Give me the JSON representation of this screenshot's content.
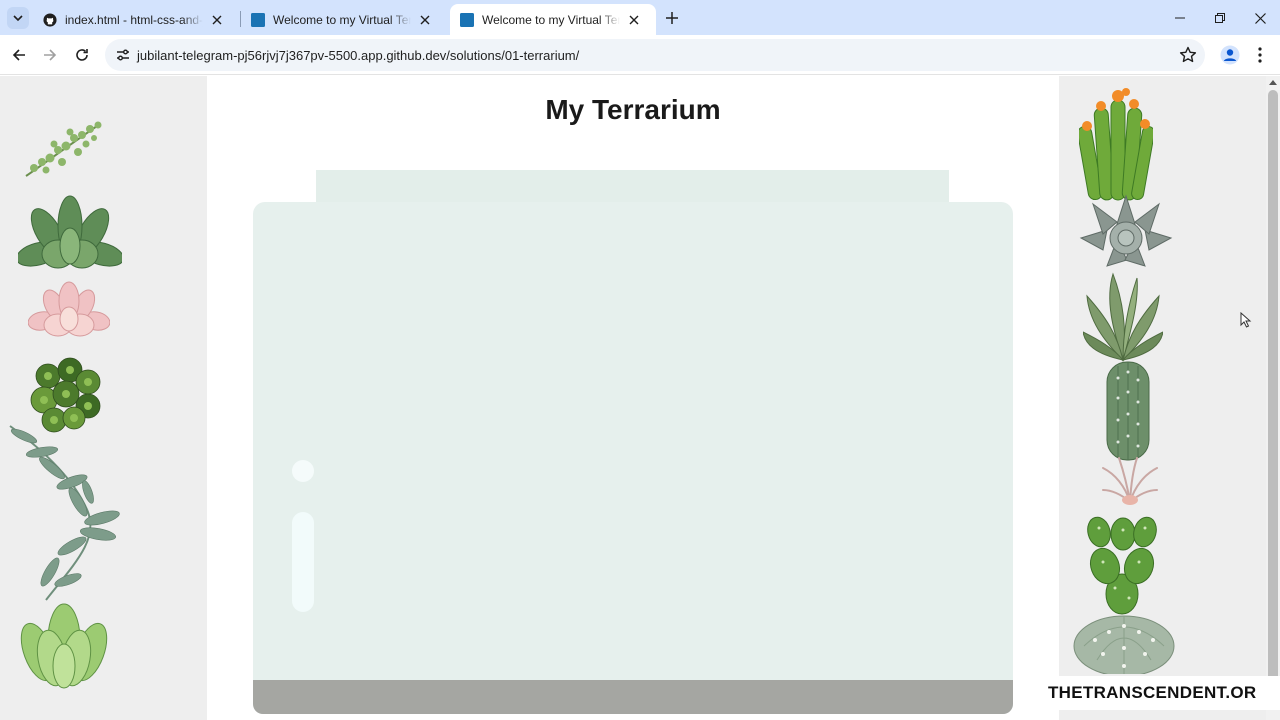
{
  "browser": {
    "tabs": [
      {
        "title": "index.html - html-css-and-javas",
        "favicon": "github-icon",
        "active": false
      },
      {
        "title": "Welcome to my Virtual Terrarium",
        "favicon": "vscode-icon",
        "active": false
      },
      {
        "title": "Welcome to my Virtual Terrarium",
        "favicon": "vscode-icon",
        "active": true
      }
    ],
    "url": "jubilant-telegram-pj56rjvj7j367pv-5500.app.github.dev/solutions/01-terrarium/",
    "colors": {
      "tabstrip": "#d3e3fd",
      "omnibox": "#f0f4f9"
    }
  },
  "page": {
    "heading": "My Terrarium",
    "left_plants": [
      "plant-sprig-icon",
      "succulent-green-icon",
      "succulent-pink-icon",
      "succulent-clustered-icon",
      "eucalyptus-branch-icon",
      "succulent-light-green-icon"
    ],
    "right_plants": [
      "cactus-flowering-icon",
      "succulent-gray-icon",
      "aloe-icon",
      "cactus-columnar-icon",
      "air-plant-icon",
      "cactus-prickly-pear-icon",
      "cactus-round-icon"
    ],
    "colors": {
      "sidebar": "#eeeeee",
      "jar": "#e6f0ed",
      "jar_top": "#e3eeea",
      "jar_bottom": "#a5a6a2"
    }
  },
  "watermark": "THETRANSCENDENT.OR"
}
